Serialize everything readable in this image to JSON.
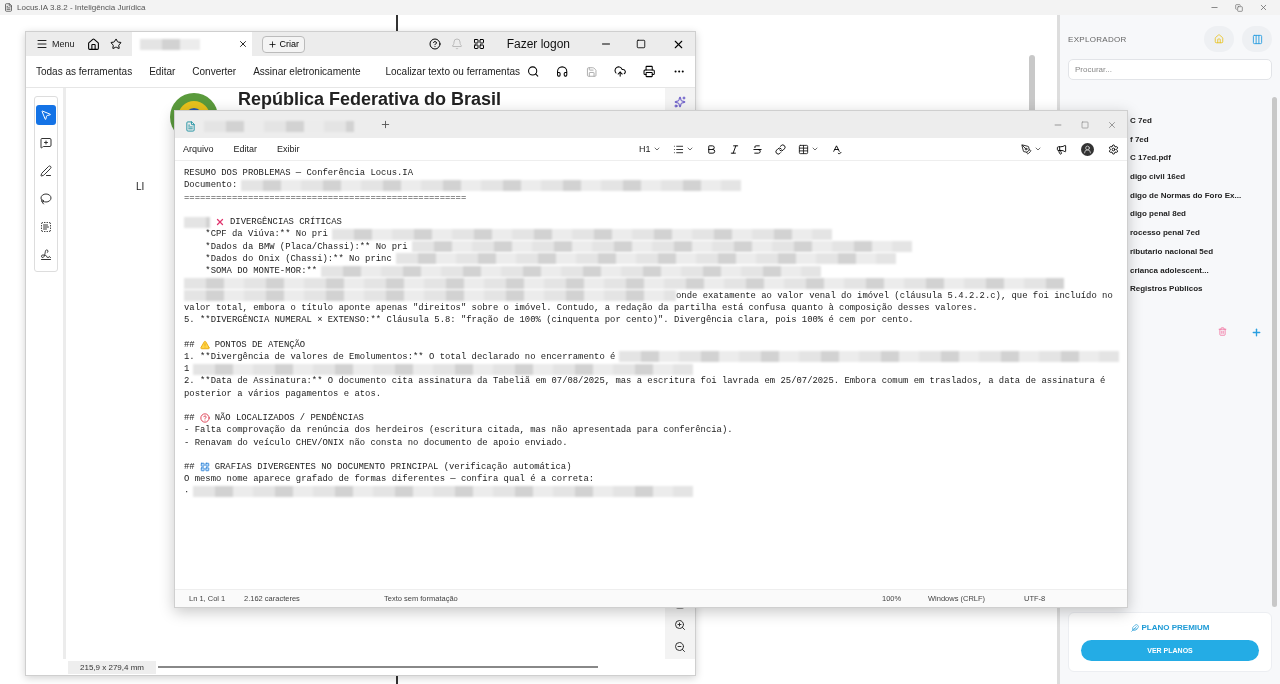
{
  "app": {
    "title": "Locus.IA 3.8.2 - Inteligência Jurídica"
  },
  "pdf_window": {
    "menu_label": "Menu",
    "create_label": "Criar",
    "logon_label": "Fazer logon",
    "tools": [
      "Todas as ferramentas",
      "Editar",
      "Converter",
      "Assinar eletronicamente"
    ],
    "search_label": "Localizar texto ou ferramentas",
    "side_tools": [
      {
        "kind": "pointer",
        "selected": true
      },
      {
        "kind": "comment",
        "selected": false
      },
      {
        "kind": "pen",
        "selected": false
      },
      {
        "kind": "lasso",
        "selected": false
      },
      {
        "kind": "text-select",
        "selected": false
      },
      {
        "kind": "signature",
        "selected": false
      }
    ],
    "document": {
      "heading": "República Federativa do Brasil",
      "fragment": "LI"
    },
    "page_size": "215,9 x 279,4 mm"
  },
  "notepad": {
    "menu": [
      "Arquivo",
      "Editar",
      "Exibir"
    ],
    "heading_style": "H1",
    "lines": [
      {
        "kind": "plain",
        "text": "RESUMO DOS PROBLEMAS — Conferência Locus.IA"
      },
      {
        "kind": "masked",
        "text": "Documento:"
      },
      {
        "kind": "plain",
        "text": "====================================================="
      },
      {
        "kind": "gap"
      },
      {
        "kind": "critical",
        "text": "DIVERGÊNCIAS CRÍTICAS"
      },
      {
        "kind": "masked",
        "text": "    *CPF da Viúva:** No pri"
      },
      {
        "kind": "masked",
        "text": "    *Dados da BMW (Placa/Chassi):** No pri"
      },
      {
        "kind": "masked",
        "text": "    *Dados do Onix (Chassi):** No princ"
      },
      {
        "kind": "masked",
        "text": "    *SOMA DO MONTE-MOR:**"
      },
      {
        "kind": "maskgap"
      },
      {
        "kind": "tail",
        "text": "onde exatamente ao valor venal do imóvel (cláusula 5.4.2.2.c), que foi incluído no"
      },
      {
        "kind": "plain",
        "text": "valor total, embora o título aponte apenas \"direitos\" sobre o imóvel. Contudo, a redação da partilha está confusa quanto à composição desses valores."
      },
      {
        "kind": "plain",
        "text": "5. **DIVERGÊNCIA NUMERAL × EXTENSO:** Cláusula 5.8: \"fração de 100% (cinquenta por cento)\". Divergência clara, pois 100% é cem por cento."
      },
      {
        "kind": "gap"
      },
      {
        "kind": "attention",
        "prefix": "##",
        "text": "PONTOS DE ATENÇÃO"
      },
      {
        "kind": "masked",
        "text": "1. **Divergência de valores de Emolumentos:** O total declarado no encerramento é"
      },
      {
        "kind": "masked",
        "text": "1"
      },
      {
        "kind": "plain",
        "text": "2. **Data de Assinatura:** O documento cita assinatura da Tabeliã em 07/08/2025, mas a escritura foi lavrada em 25/07/2025. Embora comum em traslados, a data de assinatura é"
      },
      {
        "kind": "plain",
        "text": "posterior a vários pagamentos e atos."
      },
      {
        "kind": "gap"
      },
      {
        "kind": "pending",
        "prefix": "##",
        "text": "NÃO LOCALIZADOS / PENDÊNCIAS"
      },
      {
        "kind": "plain",
        "text": "- Falta comprovação da renúncia dos herdeiros (escritura citada, mas não apresentada para conferência)."
      },
      {
        "kind": "plain",
        "text": "- Renavam do veículo CHEV/ONIX não consta no documento de apoio enviado."
      },
      {
        "kind": "gap"
      },
      {
        "kind": "spelling",
        "prefix": "##",
        "text": "GRAFIAS DIVERGENTES NO DOCUMENTO PRINCIPAL (verificação automática)"
      },
      {
        "kind": "plain",
        "text": "O mesmo nome aparece grafado de formas diferentes — confira qual é a correta:"
      },
      {
        "kind": "masked",
        "text": "·"
      }
    ],
    "status": {
      "position": "Ln 1, Col 1",
      "count": "2.162 caracteres",
      "format": "Texto sem formatação",
      "zoom": "100%",
      "line_ending": "Windows (CRLF)",
      "encoding": "UTF-8"
    }
  },
  "explorer": {
    "title": "EXPLORADOR",
    "search": {
      "placeholder": "Procurar..."
    },
    "items": [
      "C 7ed",
      "f 7ed",
      "C 17ed.pdf",
      "digo civil 16ed",
      "digo de Normas do Foro Ex...",
      "digo penal 8ed",
      "rocesso penal 7ed",
      "ributario nacional 5ed",
      "crianca adolescent...",
      "Registros Públicos"
    ],
    "plan": {
      "label": "PLANO PREMIUM",
      "button": "VER PLANOS"
    }
  }
}
